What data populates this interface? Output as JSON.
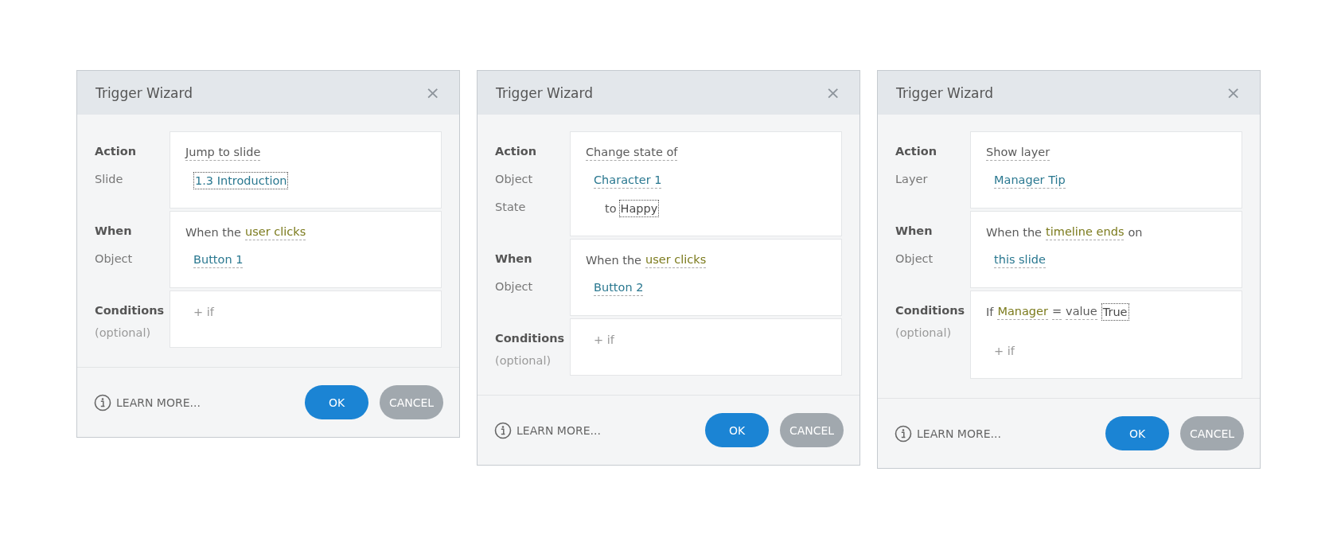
{
  "dialogs": [
    {
      "title": "Trigger Wizard",
      "close": "×",
      "sections": [
        {
          "labels": [
            {
              "text": "Action",
              "kind": "heading"
            },
            {
              "text": "Slide",
              "kind": "field"
            }
          ],
          "lines": [
            {
              "kind": "text",
              "tokens": [
                {
                  "text": "Jump to slide",
                  "kind": "option"
                }
              ]
            },
            {
              "kind": "choice",
              "tokens": [
                {
                  "text": "1.3 Introduction",
                  "kind": "link-focus"
                }
              ]
            }
          ]
        },
        {
          "labels": [
            {
              "text": "When",
              "kind": "heading"
            },
            {
              "text": "Object",
              "kind": "field"
            }
          ],
          "lines": [
            {
              "kind": "text",
              "tokens": [
                {
                  "text": "When the",
                  "kind": "plain"
                },
                {
                  "text": "user clicks",
                  "kind": "keyword"
                }
              ]
            },
            {
              "kind": "choice",
              "tokens": [
                {
                  "text": "Button 1",
                  "kind": "link"
                }
              ]
            }
          ]
        },
        {
          "labels": [
            {
              "text": "Conditions",
              "kind": "heading"
            },
            {
              "text": "(optional)",
              "kind": "note"
            }
          ],
          "lines": [
            {
              "kind": "add",
              "tokens": [
                {
                  "text": "+ if",
                  "kind": "plain"
                }
              ]
            }
          ]
        }
      ],
      "learn_more": "LEARN MORE...",
      "buttons": [
        {
          "label": "OK",
          "kind": "primary"
        },
        {
          "label": "CANCEL",
          "kind": "secondary"
        }
      ]
    },
    {
      "title": "Trigger Wizard",
      "close": "×",
      "sections": [
        {
          "labels": [
            {
              "text": "Action",
              "kind": "heading"
            },
            {
              "text": "Object",
              "kind": "field"
            },
            {
              "text": "State",
              "kind": "field"
            }
          ],
          "lines": [
            {
              "kind": "text",
              "tokens": [
                {
                  "text": "Change state of",
                  "kind": "option"
                }
              ]
            },
            {
              "kind": "choice",
              "tokens": [
                {
                  "text": "Character 1",
                  "kind": "link"
                }
              ]
            },
            {
              "kind": "sub",
              "tokens": [
                {
                  "text": "to",
                  "kind": "plain"
                },
                {
                  "text": "Happy",
                  "kind": "value"
                }
              ]
            }
          ]
        },
        {
          "labels": [
            {
              "text": "When",
              "kind": "heading"
            },
            {
              "text": "Object",
              "kind": "field"
            }
          ],
          "lines": [
            {
              "kind": "text",
              "tokens": [
                {
                  "text": "When the",
                  "kind": "plain"
                },
                {
                  "text": "user clicks",
                  "kind": "keyword"
                }
              ]
            },
            {
              "kind": "choice",
              "tokens": [
                {
                  "text": "Button 2",
                  "kind": "link"
                }
              ]
            }
          ]
        },
        {
          "labels": [
            {
              "text": "Conditions",
              "kind": "heading"
            },
            {
              "text": "(optional)",
              "kind": "note"
            }
          ],
          "lines": [
            {
              "kind": "add",
              "tokens": [
                {
                  "text": "+ if",
                  "kind": "plain"
                }
              ]
            }
          ]
        }
      ],
      "learn_more": "LEARN MORE...",
      "buttons": [
        {
          "label": "OK",
          "kind": "primary"
        },
        {
          "label": "CANCEL",
          "kind": "secondary"
        }
      ]
    },
    {
      "title": "Trigger Wizard",
      "close": "×",
      "sections": [
        {
          "labels": [
            {
              "text": "Action",
              "kind": "heading"
            },
            {
              "text": "Layer",
              "kind": "field"
            }
          ],
          "lines": [
            {
              "kind": "text",
              "tokens": [
                {
                  "text": "Show layer",
                  "kind": "option"
                }
              ]
            },
            {
              "kind": "choice",
              "tokens": [
                {
                  "text": "Manager Tip",
                  "kind": "link"
                }
              ]
            }
          ]
        },
        {
          "labels": [
            {
              "text": "When",
              "kind": "heading"
            },
            {
              "text": "Object",
              "kind": "field"
            }
          ],
          "lines": [
            {
              "kind": "text",
              "tokens": [
                {
                  "text": "When the",
                  "kind": "plain"
                },
                {
                  "text": "timeline ends",
                  "kind": "keyword"
                },
                {
                  "text": "on",
                  "kind": "plain"
                }
              ]
            },
            {
              "kind": "choice",
              "tokens": [
                {
                  "text": "this slide",
                  "kind": "link"
                }
              ]
            }
          ]
        },
        {
          "labels": [
            {
              "text": "Conditions",
              "kind": "heading"
            },
            {
              "text": "(optional)",
              "kind": "note"
            }
          ],
          "lines": [
            {
              "kind": "text",
              "tokens": [
                {
                  "text": "If",
                  "kind": "plain"
                },
                {
                  "text": "Manager",
                  "kind": "keyword"
                },
                {
                  "text": "=",
                  "kind": "option"
                },
                {
                  "text": "value",
                  "kind": "option"
                },
                {
                  "text": "True",
                  "kind": "value"
                }
              ]
            },
            {
              "kind": "add",
              "tokens": [
                {
                  "text": "+ if",
                  "kind": "plain"
                }
              ]
            }
          ]
        }
      ],
      "learn_more": "LEARN MORE...",
      "buttons": [
        {
          "label": "OK",
          "kind": "primary"
        },
        {
          "label": "CANCEL",
          "kind": "secondary"
        }
      ]
    }
  ]
}
